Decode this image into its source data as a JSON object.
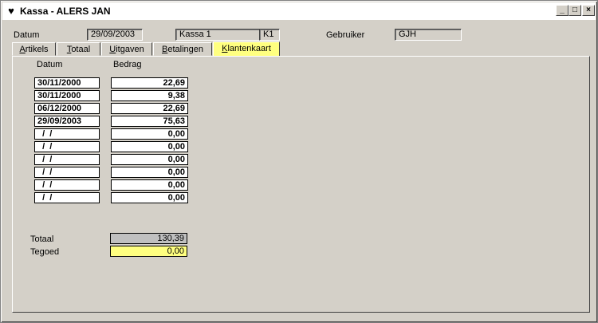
{
  "window": {
    "title": "Kassa - ALERS JAN",
    "icon": "heart-suit-icon",
    "buttons": [
      {
        "name": "minimize-button",
        "glyph": "_"
      },
      {
        "name": "maximize-button",
        "glyph": "□"
      },
      {
        "name": "close-button",
        "glyph": "×"
      }
    ]
  },
  "header": {
    "datum_label": "Datum",
    "datum_value": "29/09/2003",
    "kassa_value": "Kassa 1",
    "kassa_code": "K1",
    "gebruiker_label": "Gebruiker",
    "gebruiker_value": "GJH"
  },
  "tabs": [
    {
      "label": "Artikels",
      "accel": "A",
      "rest": "rtikels",
      "active": false
    },
    {
      "label": "Totaal",
      "accel": "T",
      "rest": "otaal",
      "active": false
    },
    {
      "label": "Uitgaven",
      "accel": "U",
      "rest": "itgaven",
      "active": false
    },
    {
      "label": "Betalingen",
      "accel": "B",
      "rest": "etalingen",
      "active": false
    },
    {
      "label": "Klantenkaart",
      "accel": "K",
      "rest": "lantenkaart",
      "active": true
    }
  ],
  "table": {
    "columns": {
      "datum": "Datum",
      "bedrag": "Bedrag"
    },
    "rows": [
      {
        "datum": "30/11/2000",
        "bedrag": "22,69"
      },
      {
        "datum": "30/11/2000",
        "bedrag": "9,38"
      },
      {
        "datum": "06/12/2000",
        "bedrag": "22,69"
      },
      {
        "datum": "29/09/2003",
        "bedrag": "75,63"
      },
      {
        "datum": "  /  /",
        "bedrag": "0,00"
      },
      {
        "datum": "  /  /",
        "bedrag": "0,00"
      },
      {
        "datum": "  /  /",
        "bedrag": "0,00"
      },
      {
        "datum": "  /  /",
        "bedrag": "0,00"
      },
      {
        "datum": "  /  /",
        "bedrag": "0,00"
      },
      {
        "datum": "  /  /",
        "bedrag": "0,00"
      }
    ]
  },
  "totals": {
    "totaal_label": "Totaal",
    "totaal_value": "130,39",
    "tegoed_label": "Tegoed",
    "tegoed_value": "0,00"
  },
  "colors": {
    "window_bg": "#d4d0c8",
    "active_tab": "#ffff80",
    "tegoed_bg": "#ffff80",
    "readonly_bg": "#c0c0c0"
  }
}
